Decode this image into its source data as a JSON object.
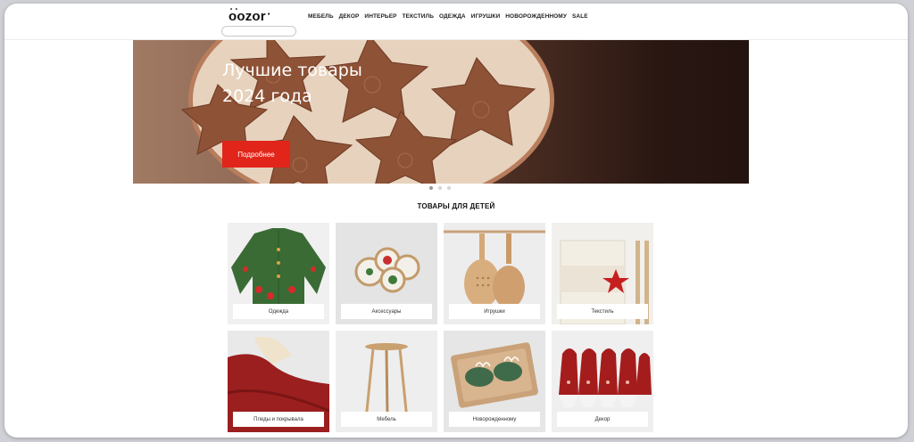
{
  "header": {
    "logo": "oozor",
    "search_placeholder": "",
    "nav": [
      "Мебель",
      "Декор",
      "Интерьер",
      "Текстиль",
      "Одежда",
      "Игрушки",
      "Новорожденному",
      "Sale"
    ]
  },
  "hero": {
    "title_line1": "Лучшие товары",
    "title_line2": "2024 года",
    "button_label": "Подробнее",
    "slides": 3,
    "active_slide": 1
  },
  "section_title": "ТОВАРЫ ДЛЯ ДЕТЕЙ",
  "categories": [
    {
      "label": "Одежда",
      "icon": "sweater-image"
    },
    {
      "label": "Аксессуары",
      "icon": "hair-ties-image"
    },
    {
      "label": "Игрушки",
      "icon": "wooden-pans-image"
    },
    {
      "label": "Текстиль",
      "icon": "crib-organizer-image"
    },
    {
      "label": "Пледы и покрывала",
      "icon": "blanket-image"
    },
    {
      "label": "Мебель",
      "icon": "stool-image"
    },
    {
      "label": "Новорожденному",
      "icon": "booties-image"
    },
    {
      "label": "Декор",
      "icon": "gnomes-image"
    }
  ],
  "colors": {
    "accent": "#e1251b"
  }
}
